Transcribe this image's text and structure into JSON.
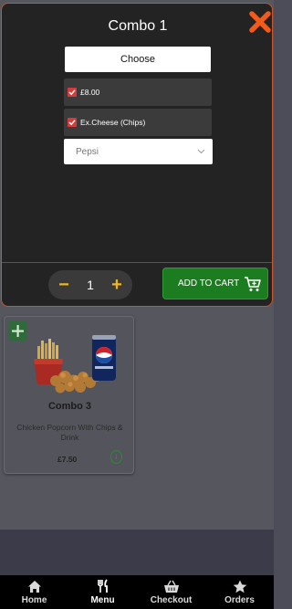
{
  "modal": {
    "title": "Combo 1",
    "choose_label": "Choose",
    "options": [
      {
        "label": "£8.00",
        "checked": true
      },
      {
        "label": "Ex.Cheese (Chips)",
        "checked": true
      }
    ],
    "drink_select": {
      "selected": "Pepsi"
    },
    "quantity": "1",
    "minus_symbol": "−",
    "plus_symbol": "+",
    "add_to_cart_label": "ADD TO CART"
  },
  "product": {
    "name": "Combo 3",
    "description": "Chicken Popcorn With Chips & Drink",
    "price": "£7.50",
    "info_symbol": "i"
  },
  "nav": {
    "items": [
      {
        "label": "Home",
        "icon": "home-icon"
      },
      {
        "label": "Menu",
        "icon": "cutlery-icon"
      },
      {
        "label": "Checkout",
        "icon": "basket-icon"
      },
      {
        "label": "Orders",
        "icon": "star-icon"
      }
    ],
    "active": "Menu"
  },
  "colors": {
    "accent_yellow": "#f0b71c",
    "close_orange": "#f25a1a",
    "cart_green": "#1b7d1f",
    "checkbox_red": "#d43b3b",
    "modal_bg": "#232323"
  }
}
